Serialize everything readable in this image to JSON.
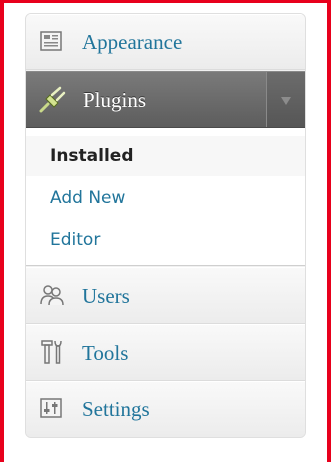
{
  "menu": {
    "appearance": {
      "label": "Appearance",
      "icon": "appearance-icon"
    },
    "plugins": {
      "label": "Plugins",
      "icon": "plug-icon",
      "state": "expanded"
    },
    "plugins_submenu": [
      {
        "label": "Installed",
        "current": true
      },
      {
        "label": "Add New",
        "current": false
      },
      {
        "label": "Editor",
        "current": false
      }
    ],
    "users": {
      "label": "Users",
      "icon": "users-icon"
    },
    "tools": {
      "label": "Tools",
      "icon": "tools-icon"
    },
    "settings": {
      "label": "Settings",
      "icon": "settings-icon"
    }
  },
  "colors": {
    "link": "#21759b",
    "active_bg": "#6b6b6b",
    "highlight_border": "#e8001c"
  }
}
